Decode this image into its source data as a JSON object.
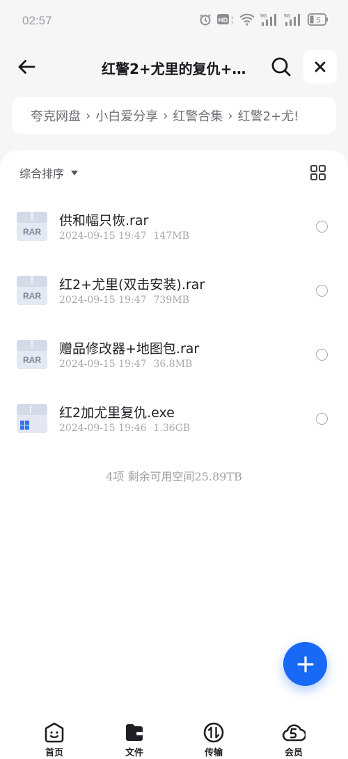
{
  "status_bar": {
    "time": "02:57",
    "hd_label": "HD",
    "sim1_label": "5G",
    "sim2_label": "5G",
    "battery": "5",
    "icons": [
      "alarm-icon",
      "hd-call-icon",
      "wifi-icon",
      "signal-5g-icon",
      "signal-5g-icon",
      "battery-icon"
    ]
  },
  "header": {
    "title": "红警2+尤里的复仇+…",
    "back_icon": "arrow-left-icon",
    "search_icon": "search-icon",
    "close_icon": "close-icon"
  },
  "breadcrumb": {
    "items": [
      "夸克网盘",
      "小白爱分享",
      "红警合集",
      "红警2+尤!"
    ],
    "separator": "›"
  },
  "toolbar": {
    "sort_label": "综合排序",
    "sort_icon": "caret-down-icon",
    "view_icon": "grid-view-icon"
  },
  "files": [
    {
      "name": "供和幅只恢.rar",
      "date": "2024-09-15 19:47",
      "size": "147MB",
      "type": "rar",
      "icon_text": "RAR"
    },
    {
      "name": "红2+尤里(双击安装).rar",
      "date": "2024-09-15 19:47",
      "size": "739MB",
      "type": "rar",
      "icon_text": "RAR"
    },
    {
      "name": "赠品修改器+地图包.rar",
      "date": "2024-09-15 19:47",
      "size": "36.8MB",
      "type": "rar",
      "icon_text": "RAR"
    },
    {
      "name": "红2加尤里复仇.exe",
      "date": "2024-09-15 19:46",
      "size": "1.36GB",
      "type": "exe",
      "icon_text": ""
    }
  ],
  "summary": "4项  剩余可用空间25.89TB",
  "fab_icon": "plus-icon",
  "nav": [
    {
      "label": "首页",
      "icon": "home-face-icon"
    },
    {
      "label": "文件",
      "icon": "folder-icon"
    },
    {
      "label": "传输",
      "icon": "transfer-icon"
    },
    {
      "label": "会员",
      "icon": "vip-cloud-icon"
    }
  ],
  "colors": {
    "accent": "#1769f6",
    "background": "#f6f6f7",
    "panel": "#ffffff",
    "text_primary": "#1e1e24",
    "text_secondary": "#a8a8ae"
  }
}
